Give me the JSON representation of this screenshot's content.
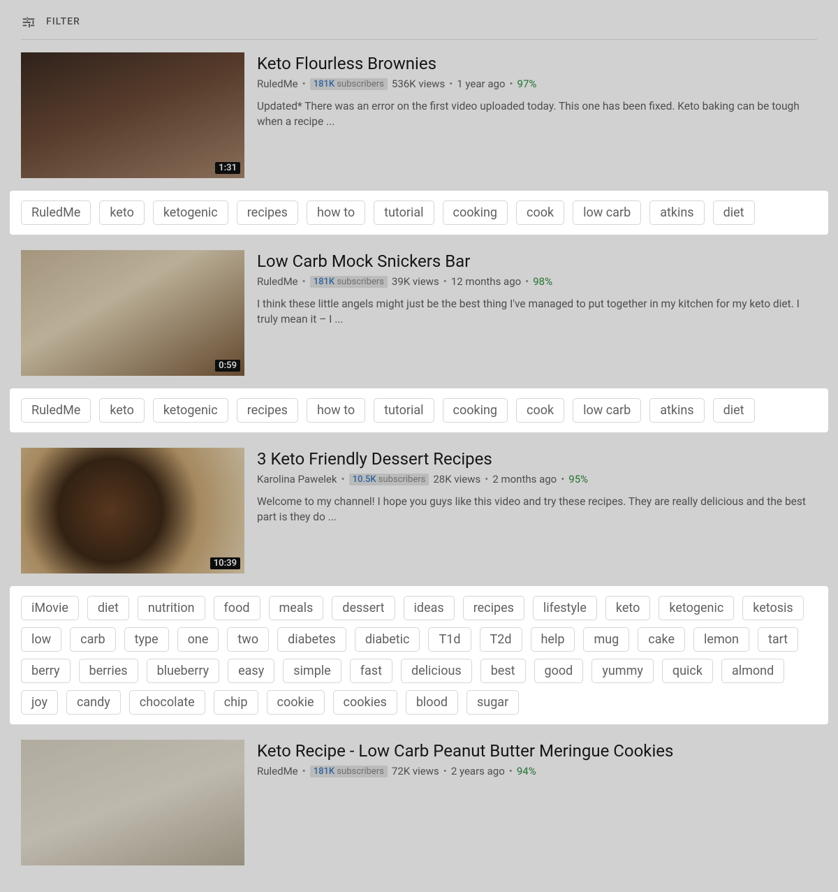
{
  "filter": {
    "label": "FILTER"
  },
  "results": [
    {
      "title": "Keto Flourless Brownies",
      "channel": "RuledMe",
      "subscribers": "181K",
      "subs_label": "subscribers",
      "views": "536K views",
      "age": "1 year ago",
      "rating": "97%",
      "description": "Updated* There was an error on the first video uploaded today. This one has been fixed. Keto baking can be tough when a recipe ...",
      "duration": "1:31",
      "tags": [
        "RuledMe",
        "keto",
        "ketogenic",
        "recipes",
        "how to",
        "tutorial",
        "cooking",
        "cook",
        "low carb",
        "atkins",
        "diet"
      ]
    },
    {
      "title": "Low Carb Mock Snickers Bar",
      "channel": "RuledMe",
      "subscribers": "181K",
      "subs_label": "subscribers",
      "views": "39K views",
      "age": "12 months ago",
      "rating": "98%",
      "description": "I think these little angels might just be the best thing I've managed to put together in my kitchen for my keto diet. I truly mean it – I ...",
      "duration": "0:59",
      "tags": [
        "RuledMe",
        "keto",
        "ketogenic",
        "recipes",
        "how to",
        "tutorial",
        "cooking",
        "cook",
        "low carb",
        "atkins",
        "diet"
      ]
    },
    {
      "title": "3 Keto Friendly Dessert Recipes",
      "channel": "Karolina Pawelek",
      "subscribers": "10.5K",
      "subs_label": "subscribers",
      "views": "28K views",
      "age": "2 months ago",
      "rating": "95%",
      "description": "Welcome to my channel! I hope you guys like this video and try these recipes. They are really delicious and the best part is they do ...",
      "duration": "10:39",
      "tags": [
        "iMovie",
        "diet",
        "nutrition",
        "food",
        "meals",
        "dessert",
        "ideas",
        "recipes",
        "lifestyle",
        "keto",
        "ketogenic",
        "ketosis",
        "low",
        "carb",
        "type",
        "one",
        "two",
        "diabetes",
        "diabetic",
        "T1d",
        "T2d",
        "help",
        "mug",
        "cake",
        "lemon",
        "tart",
        "berry",
        "berries",
        "blueberry",
        "easy",
        "simple",
        "fast",
        "delicious",
        "best",
        "good",
        "yummy",
        "quick",
        "almond",
        "joy",
        "candy",
        "chocolate",
        "chip",
        "cookie",
        "cookies",
        "blood",
        "sugar"
      ]
    },
    {
      "title": "Keto Recipe - Low Carb Peanut Butter Meringue Cookies",
      "channel": "RuledMe",
      "subscribers": "181K",
      "subs_label": "subscribers",
      "views": "72K views",
      "age": "2 years ago",
      "rating": "94%",
      "description": "",
      "duration": "",
      "tags": []
    }
  ]
}
